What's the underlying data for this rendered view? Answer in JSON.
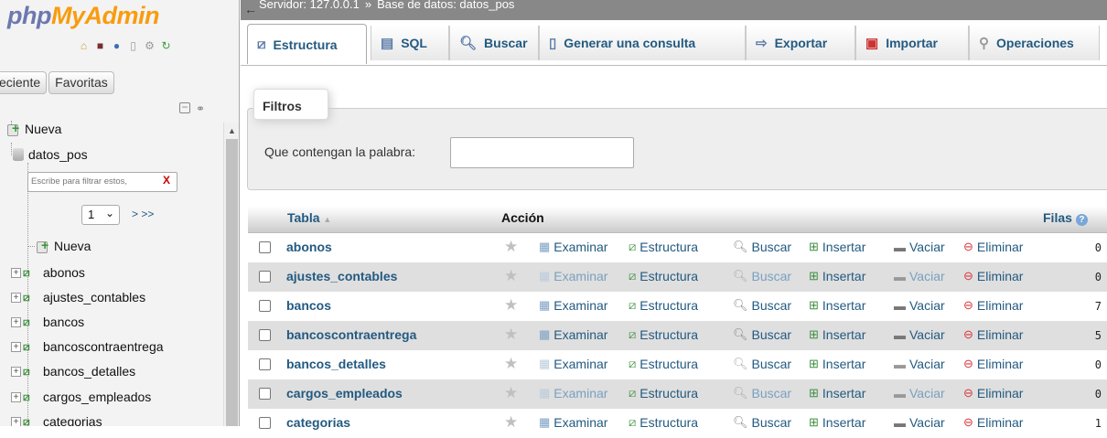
{
  "nav": {
    "logo_php": "php",
    "logo_myadmin": "MyAdmin",
    "icons": [
      "home-icon",
      "logout-icon",
      "help-icon",
      "docs-icon",
      "settings-icon",
      "reload-icon"
    ],
    "tab_recent": "eciente",
    "tab_favorites": "Favoritas",
    "new_label": "Nueva",
    "database": "datos_pos",
    "filter_placeholder": "Escribe para filtrar estos,",
    "filter_clear": "X",
    "page_value": "1",
    "page_next": "> >>",
    "db_new_label": "Nueva",
    "tables": [
      "abonos",
      "ajustes_contables",
      "bancos",
      "bancoscontraentrega",
      "bancos_detalles",
      "cargos_empleados",
      "categorias"
    ]
  },
  "topbar": {
    "back": "←",
    "server": "Servidor: 127.0.0.1",
    "separator": "»",
    "database": "Base de datos: datos_pos"
  },
  "tabs": {
    "estructura": "Estructura",
    "sql": "SQL",
    "buscar": "Buscar",
    "generar": "Generar una consulta",
    "exportar": "Exportar",
    "importar": "Importar",
    "operaciones": "Operaciones"
  },
  "filter": {
    "legend": "Filtros",
    "label": "Que contengan la palabra:",
    "value": ""
  },
  "table": {
    "col_tabla": "Tabla",
    "col_accion": "Acción",
    "col_filas": "Filas",
    "actions": {
      "examinar": "Examinar",
      "estructura": "Estructura",
      "buscar": "Buscar",
      "insertar": "Insertar",
      "vaciar": "Vaciar",
      "eliminar": "Eliminar"
    },
    "rows": [
      {
        "name": "abonos",
        "rows": "0"
      },
      {
        "name": "ajustes_contables",
        "rows": "0"
      },
      {
        "name": "bancos",
        "rows": "7"
      },
      {
        "name": "bancoscontraentrega",
        "rows": "5"
      },
      {
        "name": "bancos_detalles",
        "rows": "0"
      },
      {
        "name": "cargos_empleados",
        "rows": "0"
      },
      {
        "name": "categorias",
        "rows": "1"
      }
    ]
  },
  "colors": {
    "link": "#235a81",
    "logo_php": "#6c78af",
    "logo_myadmin": "#f89c0e",
    "delete_red": "#d9363e",
    "row_alt": "#dfdfdf"
  }
}
